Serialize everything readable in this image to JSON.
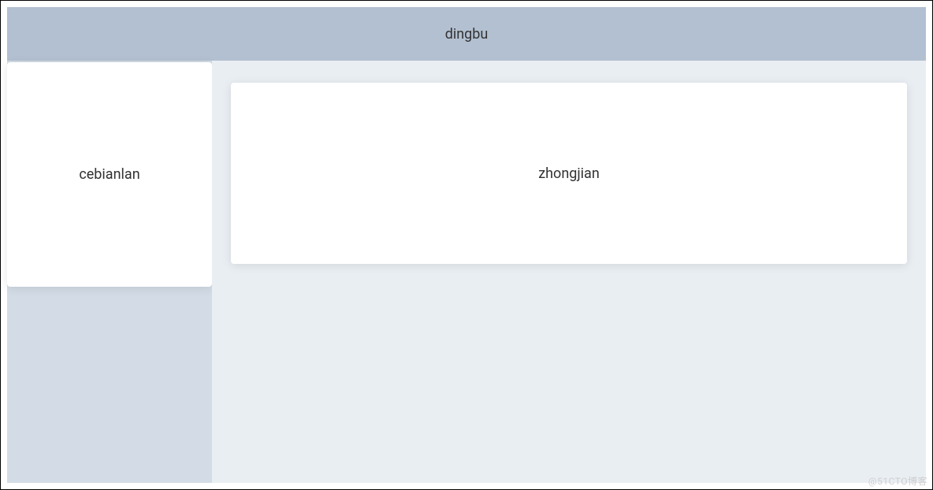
{
  "header": {
    "title": "dingbu"
  },
  "aside": {
    "label": "cebianlan"
  },
  "main": {
    "label": "zhongjian"
  },
  "watermark": "@51CTO博客",
  "colors": {
    "header_bg": "#b3c0d1",
    "aside_bg": "#d3dce6",
    "main_bg": "#e9eef3",
    "card_bg": "#ffffff"
  }
}
